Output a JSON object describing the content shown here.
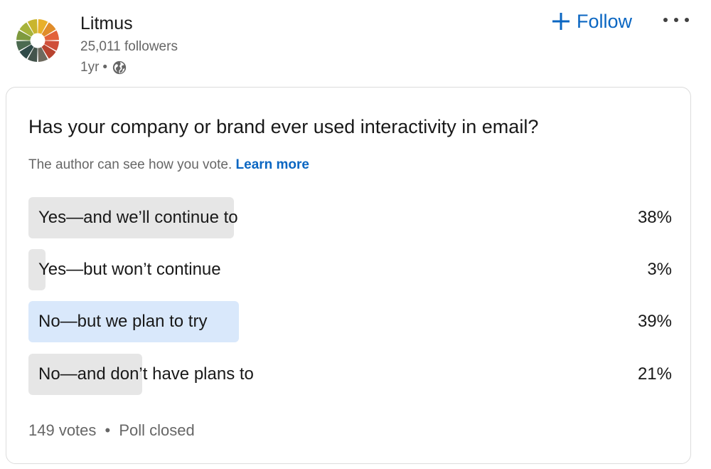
{
  "post_header": {
    "company_name": "Litmus",
    "followers": "25,011 followers",
    "age": "1yr",
    "separator": "•",
    "visibility_icon": "globe-icon",
    "follow_label": "Follow",
    "follow_icon": "plus-icon",
    "more_icon": "more-horizontal-icon",
    "accent_color": "#0a66c2"
  },
  "poll": {
    "question": "Has your company or brand ever used interactivity in email?",
    "note": "The author can see how you vote.",
    "learn_more": "Learn more",
    "options": [
      {
        "label": "Yes—and we’ll continue to",
        "percent_text": "38%",
        "percent": 38,
        "selected": false
      },
      {
        "label": "Yes—but won’t continue",
        "percent_text": "3%",
        "percent": 3,
        "selected": false
      },
      {
        "label": "No—but we plan to try",
        "percent_text": "39%",
        "percent": 39,
        "selected": true
      },
      {
        "label": "No—and don’t have plans to",
        "percent_text": "21%",
        "percent": 21,
        "selected": false
      }
    ],
    "votes": "149 votes",
    "separator": "•",
    "status": "Poll closed",
    "bar_color": "#e6e6e6",
    "selected_bar_color": "#d9e8fb"
  }
}
